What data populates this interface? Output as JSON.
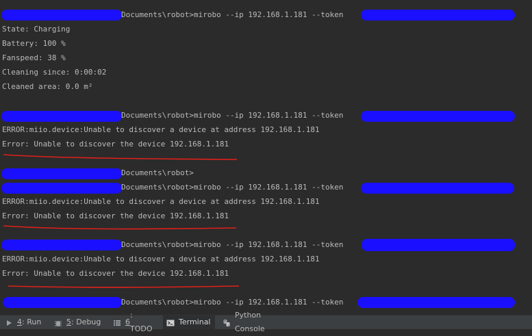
{
  "terminal": {
    "lines": [
      {
        "text": "Documents\\robot>mirobo --ip 192.168.1.181 --token"
      },
      {
        "text": "State: Charging"
      },
      {
        "text": "Battery: 100 %"
      },
      {
        "text": "Fanspeed: 38 %"
      },
      {
        "text": "Cleaning since: 0:00:02"
      },
      {
        "text": "Cleaned area: 0.0 m²"
      },
      {
        "text": "Documents\\robot>mirobo --ip 192.168.1.181 --token"
      },
      {
        "text": "ERROR:miio.device:Unable to discover a device at address 192.168.1.181"
      },
      {
        "text": "Error: Unable to discover the device 192.168.1.181"
      },
      {
        "text": "Documents\\robot>"
      },
      {
        "text": "Documents\\robot>mirobo --ip 192.168.1.181 --token"
      },
      {
        "text": "ERROR:miio.device:Unable to discover a device at address 192.168.1.181"
      },
      {
        "text": "Error: Unable to discover the device 192.168.1.181"
      },
      {
        "text": "Documents\\robot>mirobo --ip 192.168.1.181 --token"
      },
      {
        "text": "ERROR:miio.device:Unable to discover a device at address 192.168.1.181"
      },
      {
        "text": "Error: Unable to discover the device 192.168.1.181"
      },
      {
        "text": "Documents\\robot>mirobo --ip 192.168.1.181 --token"
      }
    ]
  },
  "bottombar": {
    "tabs": [
      {
        "key": "4",
        "label": ": Run",
        "icon": "run-icon"
      },
      {
        "key": "5",
        "label": ": Debug",
        "icon": "debug-icon"
      },
      {
        "key": "6",
        "label": ": TODO",
        "icon": "todo-icon"
      },
      {
        "key": "",
        "label": "Terminal",
        "icon": "terminal-icon",
        "active": true
      },
      {
        "key": "",
        "label": "Python Console",
        "icon": "python-console-icon"
      }
    ]
  },
  "colors": {
    "background": "#2b2b2b",
    "text": "#bbbbbb",
    "redaction": "#1a10ff",
    "annotation": "#e0201a",
    "toolbar": "#3c3f41"
  }
}
